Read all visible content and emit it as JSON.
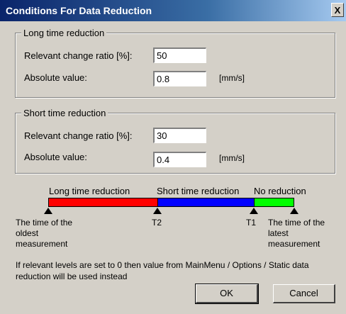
{
  "window": {
    "title": "Conditions For Data Reduction",
    "close_label": "X"
  },
  "long_group": {
    "legend": "Long time reduction",
    "ratio_label": "Relevant change ratio [%]:",
    "ratio_value": "50",
    "absolute_label": "Absolute value:",
    "absolute_value": "0.8",
    "unit": "[mm/s]"
  },
  "short_group": {
    "legend": "Short time reduction",
    "ratio_label": "Relevant change ratio [%]:",
    "ratio_value": "30",
    "absolute_label": "Absolute value:",
    "absolute_value": "0.4",
    "unit": "[mm/s]"
  },
  "timeline": {
    "long_label": "Long time reduction",
    "short_label": "Short time reduction",
    "none_label": "No reduction",
    "long_color": "#ff0000",
    "short_color": "#0000ff",
    "none_color": "#00ff00",
    "marker_oldest": "The time of the oldest measurement",
    "marker_t2": "T2",
    "marker_t1": "T1",
    "marker_latest": "The time of the latest measurement"
  },
  "note": "If relevant levels are set to 0 then value from MainMenu / Options / Static data reduction will be used instead",
  "buttons": {
    "ok": "OK",
    "cancel": "Cancel"
  }
}
